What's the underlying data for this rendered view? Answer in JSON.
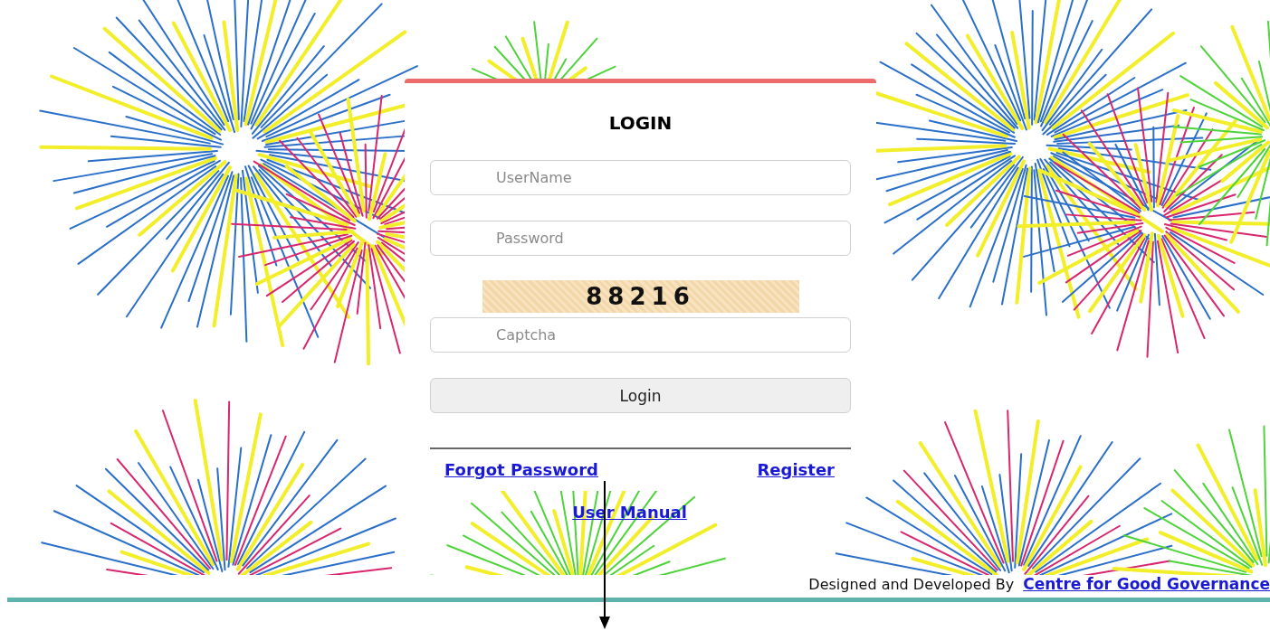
{
  "login": {
    "title": "LOGIN",
    "fields": [
      {
        "placeholder": "UserName"
      },
      {
        "placeholder": "Password"
      }
    ],
    "captcha": {
      "code": "88216",
      "placeholder": "Captcha"
    },
    "button": "Login",
    "links": [
      "Forgot Password",
      "Register"
    ],
    "manual_link": "User Manual"
  },
  "footer": {
    "text": "Designed and Developed By",
    "link": "Centre for Good Governance"
  }
}
